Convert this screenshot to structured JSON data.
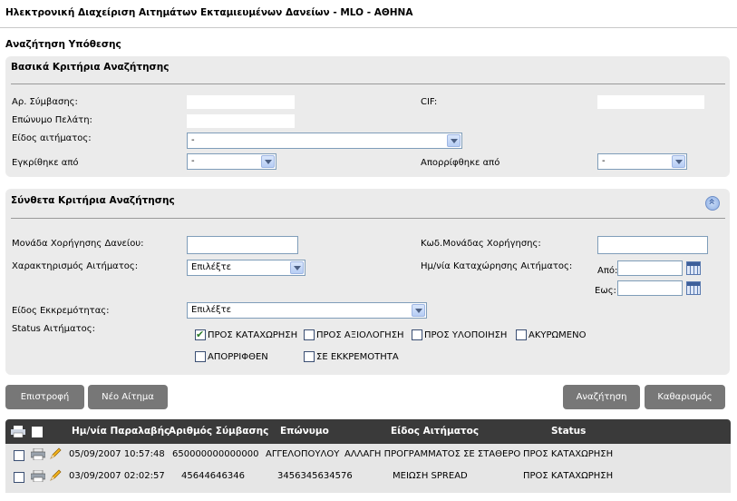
{
  "app_title": "Ηλεκτρονική Διαχείριση Αιτημάτων Εκταμιευμένων Δανείων - MLO - ΑΘΗΝΑ",
  "page_heading": "Αναζήτηση Υπόθεσης",
  "basic": {
    "title": "Βασικά Κριτήρια Αναζήτησης",
    "contract_no_label": "Αρ. Σύμβασης:",
    "contract_no_value": "",
    "cif_label": "CIF:",
    "cif_value": "",
    "surname_label": "Επώνυμο Πελάτη:",
    "surname_value": "",
    "request_type_label": "Είδος αιτήματος:",
    "request_type_value": "-",
    "approved_by_label": "Εγκρίθηκε από",
    "approved_by_value": "-",
    "rejected_by_label": "Απορρίφθηκε από",
    "rejected_by_value": "-"
  },
  "advanced": {
    "title": "Σύνθετα Κριτήρια Αναζήτησης",
    "collapse_icon": "chevron-up-circle-icon",
    "unit_label": "Μονάδα Χορήγησης Δανείου:",
    "unit_value": "",
    "unit_code_label": "Κωδ.Μονάδας Χορήγησης:",
    "unit_code_value": "",
    "characterization_label": "Χαρακτηρισμός Αιτήματος:",
    "characterization_value": "Επιλέξτε",
    "reg_date_label": "Ημ/νία Καταχώρησης Αιτήματος:",
    "from_label": "Από:",
    "from_value": "",
    "to_label": "Εως:",
    "to_value": "",
    "pending_type_label": "Είδος Εκκρεμότητας:",
    "pending_type_value": "Επιλέξτε",
    "status_label": "Status Αιτήματος:",
    "statuses": [
      {
        "label": "ΠΡΟΣ ΚΑΤΑΧΩΡΗΣΗ",
        "checked": true
      },
      {
        "label": "ΠΡΟΣ ΑΞΙΟΛΟΓΗΣΗ",
        "checked": false
      },
      {
        "label": "ΠΡΟΣ ΥΛΟΠΟΙΗΣΗ",
        "checked": false
      },
      {
        "label": "ΑΚΥΡΩΜΕΝΟ",
        "checked": false
      },
      {
        "label": "ΑΠΟΡΡΙΦΘΕΝ",
        "checked": false
      },
      {
        "label": "ΣΕ ΕΚΚΡΕΜΟΤΗΤΑ",
        "checked": false
      }
    ]
  },
  "buttons": {
    "back": "Επιστροφή",
    "new_request": "Νέο Αίτημα",
    "search": "Αναζήτηση",
    "clear": "Καθαρισμός"
  },
  "grid": {
    "headers": [
      "Ημ/νία Παραλαβής",
      "Αριθμός Σύμβασης",
      "Επώνυμο",
      "Είδος Αιτήματος",
      "Status"
    ],
    "rows": [
      {
        "date": "05/09/2007 10:57:48",
        "contract": "650000000000000",
        "surname": "ΑΓΓΕΛΟΠΟΥΛΟΥ",
        "type": "ΑΛΛΑΓΗ ΠΡΟΓΡΑΜΜΑΤΟΣ ΣΕ ΣΤΑΘΕΡΟ",
        "status": "ΠΡΟΣ ΚΑΤΑΧΩΡΗΣΗ"
      },
      {
        "date": "03/09/2007 02:02:57",
        "contract": "45644646346",
        "surname": "3456345634576",
        "type": "ΜΕΙΩΣΗ SPREAD",
        "status": "ΠΡΟΣ ΚΑΤΑΧΩΡΗΣΗ"
      }
    ]
  }
}
